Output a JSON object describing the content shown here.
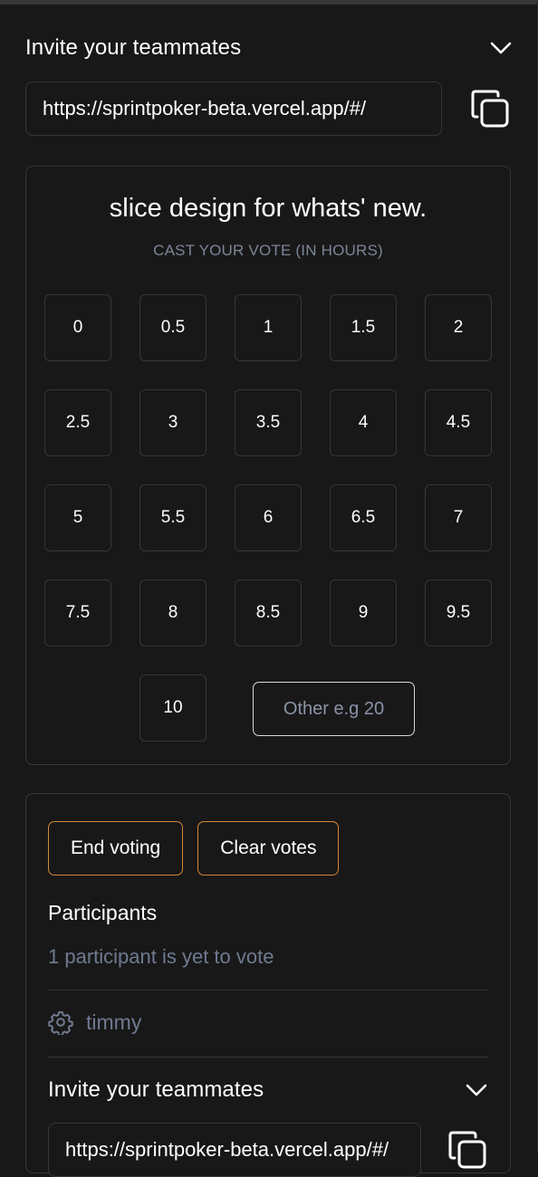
{
  "invite": {
    "title": "Invite your teammates",
    "url": "https://sprintpoker-beta.vercel.app/#/",
    "chevron_icon": "chevron-down-icon",
    "copy_icon": "copy-icon"
  },
  "voting": {
    "story_title": "slice design for whats' new.",
    "subtitle": "CAST YOUR VOTE (IN HOURS)",
    "options": [
      "0",
      "0.5",
      "1",
      "1.5",
      "2",
      "2.5",
      "3",
      "3.5",
      "4",
      "4.5",
      "5",
      "5.5",
      "6",
      "6.5",
      "7",
      "7.5",
      "8",
      "8.5",
      "9",
      "9.5",
      "10"
    ],
    "other_placeholder": "Other e.g 20"
  },
  "controls": {
    "end_voting_label": "End voting",
    "clear_votes_label": "Clear votes",
    "participants_heading": "Participants",
    "yet_to_vote": "1 participant is yet to vote",
    "participants": [
      {
        "name": "timmy",
        "icon": "gear-icon"
      }
    ]
  },
  "invite_bottom": {
    "title": "Invite your teammates",
    "url": "https://sprintpoker-beta.vercel.app/#/",
    "chevron_icon": "chevron-down-icon",
    "copy_icon": "copy-icon"
  },
  "colors": {
    "background": "#181818",
    "border": "#33363d",
    "accent_orange": "#d4883a",
    "muted_text": "#6f7a90"
  }
}
